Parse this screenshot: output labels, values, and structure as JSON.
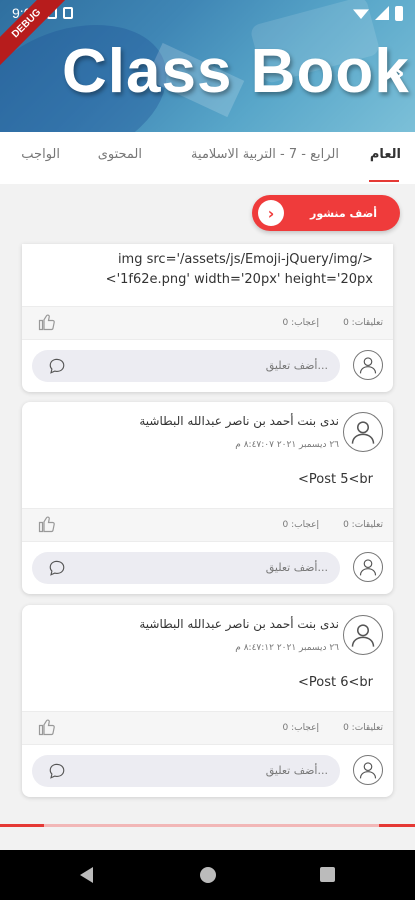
{
  "status_bar": {
    "time": "9:03"
  },
  "debug_banner": "DEBUG",
  "header": {
    "title": "Class Book"
  },
  "tabs": [
    {
      "label": "العام",
      "active": true
    },
    {
      "label": "الرابع - 7 - التربية الاسلامية",
      "active": false
    },
    {
      "label": "المحتوى",
      "active": false
    },
    {
      "label": "الواجب",
      "active": false
    }
  ],
  "add_post": {
    "label": "أضف منشور"
  },
  "posts": [
    {
      "body_line1": "img src='/assets/js/Emoji-jQuery/img/>",
      "body_line2": "<'1f62e.png' width='20px' height='20px",
      "likes": "إعجاب: 0",
      "comments": "تعليقات: 0",
      "comment_placeholder": "أضف تعليق..."
    },
    {
      "author": "ندى بنت أحمد بن ناصر عبدالله البطاشية",
      "date": "٢٦ ديسمبر ٢٠٢١ ٨:٤٧:٠٧ م",
      "body": "<Post 5<br",
      "likes": "إعجاب: 0",
      "comments": "تعليقات: 0",
      "comment_placeholder": "أضف تعليق..."
    },
    {
      "author": "ندى بنت أحمد بن ناصر عبدالله البطاشية",
      "date": "٢٦ ديسمبر ٢٠٢١ ٨:٤٧:١٢ م",
      "body": "<Post 6<br",
      "likes": "إعجاب: 0",
      "comments": "تعليقات: 0",
      "comment_placeholder": "أضف تعليق..."
    }
  ],
  "colors": {
    "accent": "#ef3b3b",
    "header_start": "#2f6f9f",
    "header_end": "#7cc0d8"
  }
}
